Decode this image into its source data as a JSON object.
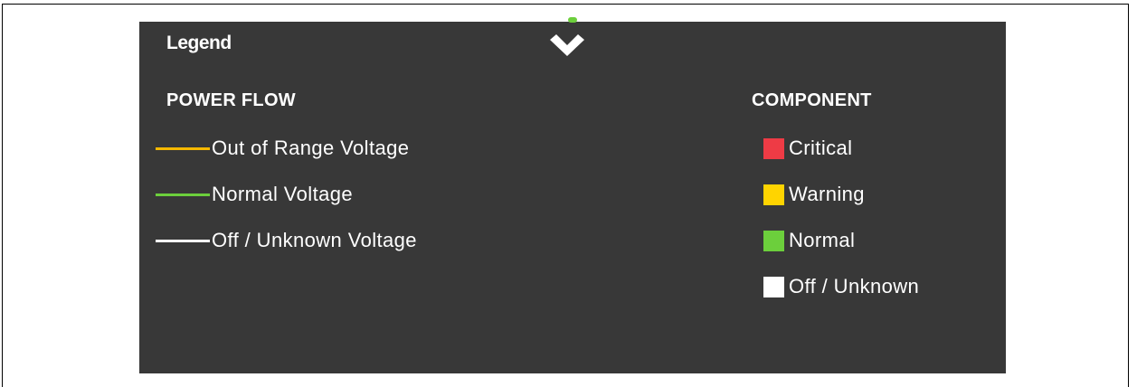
{
  "legend": {
    "title": "Legend",
    "collapse_icon": "chevron-down-icon"
  },
  "power_flow": {
    "heading": "POWER FLOW",
    "items": [
      {
        "label": "Out of Range Voltage",
        "color": "#f5b800"
      },
      {
        "label": "Normal Voltage",
        "color": "#6ccf3c"
      },
      {
        "label": "Off / Unknown Voltage",
        "color": "#ffffff"
      }
    ]
  },
  "component": {
    "heading": "COMPONENT",
    "items": [
      {
        "label": "Critical",
        "color": "#ee3b45"
      },
      {
        "label": "Warning",
        "color": "#ffd400"
      },
      {
        "label": "Normal",
        "color": "#6ccf3c"
      },
      {
        "label": "Off / Unknown",
        "color": "#ffffff"
      }
    ]
  },
  "colors": {
    "panel_background": "#383838",
    "text": "#ffffff",
    "top_indicator": "#6ccf3c"
  }
}
